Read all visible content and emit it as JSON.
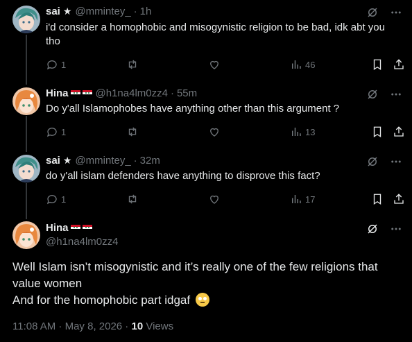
{
  "tweets": [
    {
      "name": "sai",
      "handle": "@mmintey_",
      "time": "1h",
      "text_lines": [
        "i'd consider a homophobic and misogynistic religion to be bad, idk abt you",
        "tho"
      ],
      "replies": "1",
      "views": "46"
    },
    {
      "name": "Hina",
      "handle": "@h1na4lm0zz4",
      "time": "55m",
      "text_lines": [
        "Do y'all Islamophobes have anything other than this argument   ?"
      ],
      "replies": "1",
      "views": "13"
    },
    {
      "name": "sai",
      "handle": "@mmintey_",
      "time": "32m",
      "text_lines": [
        "do y'all islam defenders have anything to disprove this fact?"
      ],
      "replies": "1",
      "views": "17"
    }
  ],
  "main": {
    "name": "Hina",
    "handle": "@h1na4lm0zz4",
    "text_lines": [
      "Well Islam isn’t misogynistic and it’s really one of the few religions that",
      "value women",
      "And for the homophobic part idgaf"
    ],
    "timestamp": "11:08 AM · May 8, 2026 · ",
    "view_count": "10",
    "views_label": " Views"
  },
  "colors": {
    "background": "#000000",
    "text": "#e7e9ea",
    "muted": "#71767b",
    "line": "#333639"
  },
  "icons": [
    "more-icon",
    "grok-icon",
    "reply-icon",
    "retweet-icon",
    "like-icon",
    "views-icon",
    "bookmark-icon",
    "share-icon",
    "star-icon",
    "flag-icon",
    "eye-roll-emoji"
  ]
}
